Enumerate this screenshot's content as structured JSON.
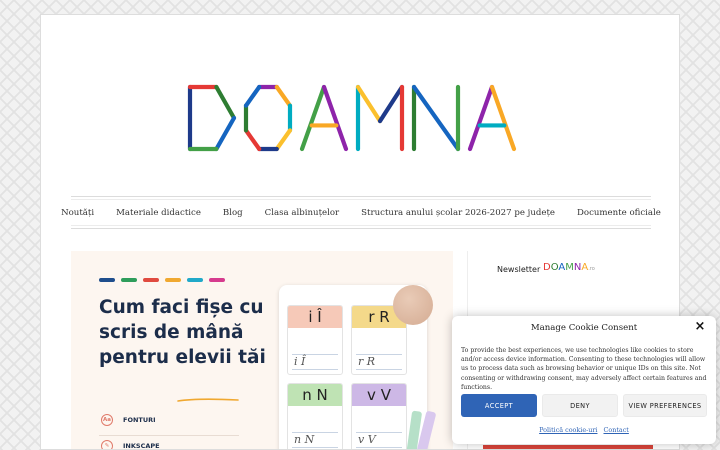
{
  "site": {
    "logo_text": "DOAMNA",
    "logo_colors": [
      "#1e3a8a",
      "#e53935",
      "#2e7d32",
      "#1565c0",
      "#43a047",
      "#8e24aa",
      "#f9a825",
      "#00acc1",
      "#fbc02d"
    ]
  },
  "nav": {
    "items": [
      {
        "label": "Noutăți"
      },
      {
        "label": "Materiale didactice"
      },
      {
        "label": "Blog"
      },
      {
        "label": "Clasa albinuțelor"
      },
      {
        "label": "Structura anului școlar 2026-2027 pe județe"
      },
      {
        "label": "Documente oficiale"
      }
    ]
  },
  "featured": {
    "title": "Cum faci fișe cu scris de mână pentru elevii tăi",
    "dash_colors": [
      "#1f4e8c",
      "#2e9d5b",
      "#e04a3f",
      "#f0a830",
      "#21a9c9",
      "#d63b8e"
    ],
    "tags": [
      {
        "icon": "font-icon",
        "glyph": "Aa",
        "label": "FONTURI"
      },
      {
        "icon": "pen-icon",
        "glyph": "✎",
        "label": "INKSCAPE"
      }
    ],
    "cards": [
      {
        "letters": "i Î",
        "script": "i Î",
        "color": "#f6c9b8"
      },
      {
        "letters": "r R",
        "script": "r R",
        "color": "#f4d98a"
      },
      {
        "letters": "n N",
        "script": "n N",
        "color": "#bfe3b4"
      },
      {
        "letters": "v V",
        "script": "v V",
        "color": "#cdb8e6"
      }
    ]
  },
  "sidebar": {
    "newsletter_label": "Newsletter",
    "newsletter_brand": "DOAMNA",
    "newsletter_suffix": ".ro"
  },
  "cookie": {
    "title": "Manage Cookie Consent",
    "body": "To provide the best experiences, we use technologies like cookies to store and/or access device information. Consenting to these technologies will allow us to process data such as browsing behavior or unique IDs on this site. Not consenting or withdrawing consent, may adversely affect certain features and functions.",
    "accept_label": "ACCEPT",
    "deny_label": "DENY",
    "preferences_label": "VIEW PREFERENCES",
    "policy_link": "Politică cookie-uri",
    "contact_link": "Contact",
    "accent": "#2f64b6"
  }
}
